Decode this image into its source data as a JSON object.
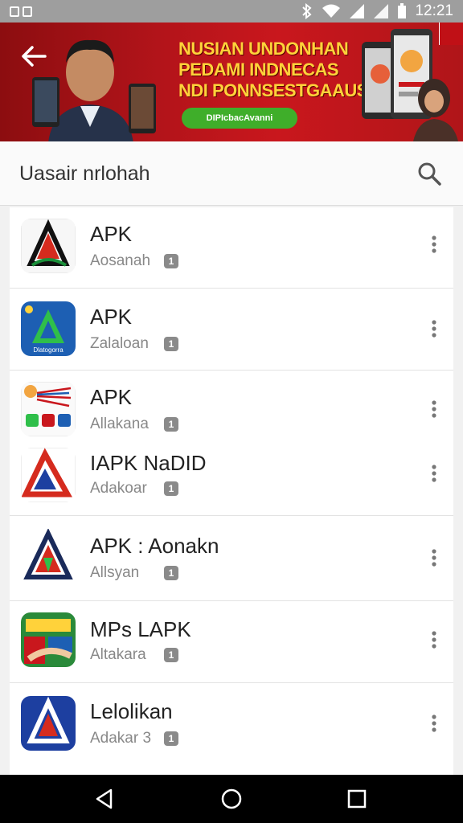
{
  "status_bar": {
    "left_icons": [
      "notification-box",
      "notification-box"
    ],
    "icons": [
      "bluetooth-icon",
      "wifi-icon",
      "signal-icon",
      "signal-icon",
      "battery-icon"
    ],
    "time": "12:21"
  },
  "banner": {
    "headline": [
      "NUSIAN UNDONHAN",
      "PEDAMI INDNECAS",
      "NDI PONNSESTGAAUS."
    ],
    "cta": "DIPIcbacAvanni",
    "colors": {
      "background": "#b3141a",
      "headline": "#ffd23a",
      "cta": "#3fae2a"
    }
  },
  "search": {
    "placeholder": "Uasair nrlohah"
  },
  "apps": [
    {
      "title": "APK",
      "subtitle": "Aosanah",
      "badge": "1"
    },
    {
      "title": "APK",
      "subtitle": "Zalaloan",
      "badge": "1"
    },
    {
      "title": "APK",
      "subtitle": "Allakana",
      "badge": "1"
    },
    {
      "title": "IAPK NaDID",
      "subtitle": "Adakoar",
      "badge": "1"
    },
    {
      "title": "APK : Aonakn",
      "subtitle": "Allsyan",
      "badge": "1"
    },
    {
      "title": "MPs LAPK",
      "subtitle": "Altakara",
      "badge": "1"
    },
    {
      "title": "Lelolikan",
      "subtitle": "Adakar 3",
      "badge": "1"
    }
  ],
  "app_icon_labels": {
    "second": "Dlatogorra"
  },
  "nav": [
    "back-nav",
    "home-nav",
    "recents-nav"
  ]
}
